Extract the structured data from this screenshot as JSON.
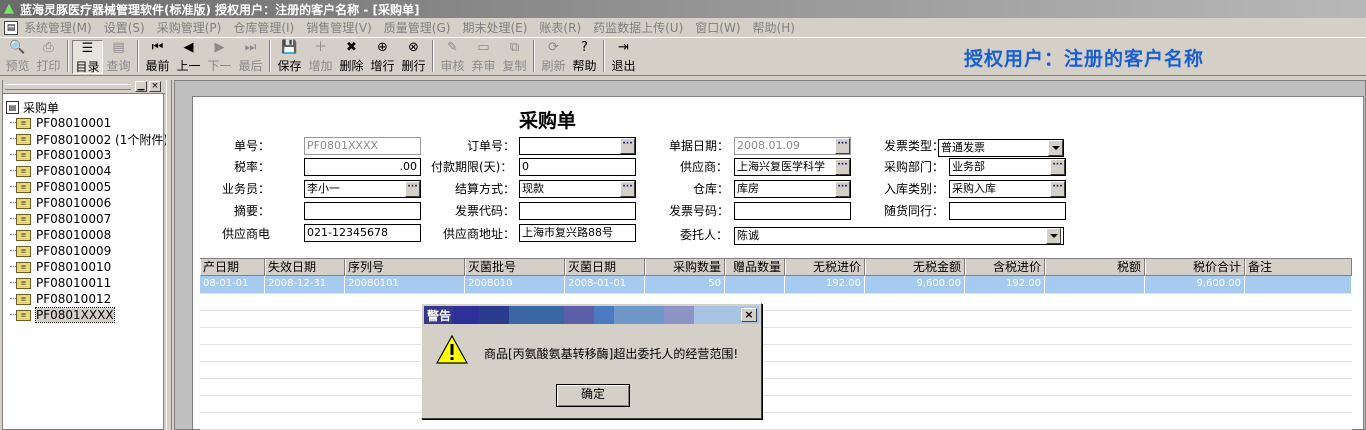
{
  "window": {
    "title": "蓝海灵豚医疗器械管理软件(标准版)  授权用户：注册的客户名称 - [采购单]"
  },
  "menu": [
    "系统管理(M)",
    "设置(S)",
    "采购管理(P)",
    "仓库管理(I)",
    "销售管理(V)",
    "质量管理(G)",
    "期末处理(E)",
    "账表(R)",
    "药监数据上传(U)",
    "窗口(W)",
    "帮助(H)"
  ],
  "toolbar": {
    "buttons": [
      {
        "label": "预览",
        "icon": "preview-icon",
        "glyph": "🔍",
        "enabled": false
      },
      {
        "label": "打印",
        "icon": "print-icon",
        "glyph": "⎙",
        "enabled": false
      },
      {
        "label": "目录",
        "icon": "list-icon",
        "glyph": "☰",
        "enabled": true,
        "pressed": true
      },
      {
        "label": "查询",
        "icon": "query-icon",
        "glyph": "▤",
        "enabled": false
      },
      {
        "label": "最前",
        "icon": "first-icon",
        "glyph": "⏮",
        "enabled": true
      },
      {
        "label": "上一",
        "icon": "prev-icon",
        "glyph": "◀",
        "enabled": true
      },
      {
        "label": "下一",
        "icon": "next-icon",
        "glyph": "▶",
        "enabled": false
      },
      {
        "label": "最后",
        "icon": "last-icon",
        "glyph": "⏭",
        "enabled": false
      },
      {
        "label": "保存",
        "icon": "save-icon",
        "glyph": "💾",
        "enabled": true
      },
      {
        "label": "增加",
        "icon": "add-icon",
        "glyph": "＋",
        "enabled": false
      },
      {
        "label": "删除",
        "icon": "delete-icon",
        "glyph": "✖",
        "enabled": true
      },
      {
        "label": "增行",
        "icon": "add-row-icon",
        "glyph": "⊕",
        "enabled": true
      },
      {
        "label": "删行",
        "icon": "delete-row-icon",
        "glyph": "⊗",
        "enabled": true
      },
      {
        "label": "审核",
        "icon": "audit-icon",
        "glyph": "✎",
        "enabled": false
      },
      {
        "label": "弃审",
        "icon": "unaudit-icon",
        "glyph": "▭",
        "enabled": false
      },
      {
        "label": "复制",
        "icon": "copy-icon",
        "glyph": "⧉",
        "enabled": false
      },
      {
        "label": "刷新",
        "icon": "refresh-icon",
        "glyph": "⟳",
        "enabled": false
      },
      {
        "label": "帮助",
        "icon": "help-icon",
        "glyph": "?",
        "enabled": true
      },
      {
        "label": "退出",
        "icon": "exit-icon",
        "glyph": "⇥",
        "enabled": true
      }
    ],
    "licensed_user": "授权用户：注册的客户名称"
  },
  "tree": {
    "root": "采购单",
    "items": [
      "PF08010001",
      "PF08010002 (1个附件)",
      "PF08010003",
      "PF08010004",
      "PF08010005",
      "PF08010006",
      "PF08010007",
      "PF08010008",
      "PF08010009",
      "PF08010010",
      "PF08010011",
      "PF08010012",
      "PF0801XXXX"
    ],
    "selected_index": 12
  },
  "form": {
    "title": "采购单",
    "fields": {
      "order_no": {
        "label": "单号：",
        "value": "PF0801XXXX"
      },
      "sub_order_no": {
        "label": "订单号：",
        "value": ""
      },
      "doc_date": {
        "label": "单据日期：",
        "value": "2008.01.09"
      },
      "invoice_type": {
        "label": "发票类型：",
        "value": "普通发票"
      },
      "tax_rate": {
        "label": "税率：",
        "value": ".00"
      },
      "pay_days": {
        "label": "付款期限(天)：",
        "value": "0"
      },
      "supplier": {
        "label": "供应商：",
        "value": "上海兴复医学科学"
      },
      "purchase_dept": {
        "label": "采购部门：",
        "value": "业务部"
      },
      "salesman": {
        "label": "业务员：",
        "value": "李小一"
      },
      "settle_method": {
        "label": "结算方式：",
        "value": "现款"
      },
      "warehouse": {
        "label": "仓库：",
        "value": "库房"
      },
      "stock_in_type": {
        "label": "入库类别：",
        "value": "采购入库"
      },
      "summary": {
        "label": "摘要：",
        "value": ""
      },
      "invoice_code": {
        "label": "发票代码：",
        "value": ""
      },
      "invoice_no": {
        "label": "发票号码：",
        "value": ""
      },
      "companion": {
        "label": "随货同行：",
        "value": ""
      },
      "supplier_phone": {
        "label": "供应商电",
        "value": "021-12345678"
      },
      "supplier_addr": {
        "label": "供应商地址：",
        "value": "上海市复兴路88号"
      },
      "consignee": {
        "label": "委托人：",
        "value": "陈诚"
      }
    }
  },
  "grid": {
    "columns": [
      "产日期",
      "失效日期",
      "序列号",
      "灭菌批号",
      "灭菌日期",
      "采购数量",
      "赠品数量",
      "无税进价",
      "无税金额",
      "含税进价",
      "税额",
      "税价合计",
      "备注"
    ],
    "rows": [
      [
        "08-01-01",
        "2008-12-31",
        "20080101",
        "2008010",
        "2008-01-01",
        "50",
        "",
        "192.00",
        "9,600.00",
        "192.00",
        "",
        "9,600.00",
        ""
      ]
    ]
  },
  "dialog": {
    "title": "警告",
    "message": "商品[丙氨酸氨基转移酶]超出委托人的经营范围!",
    "ok_label": "确定"
  },
  "colors": {
    "selection": "#a6caf0",
    "accent_text": "#1a5fd1"
  }
}
